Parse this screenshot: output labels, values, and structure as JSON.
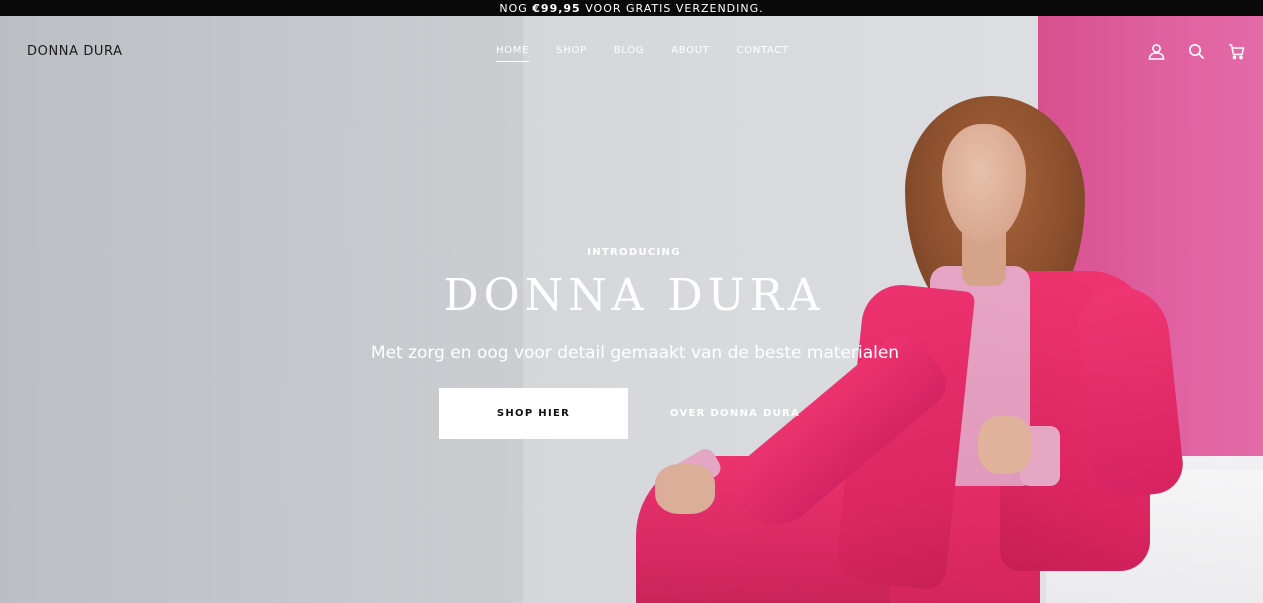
{
  "announcement": {
    "prefix": "NOG ",
    "amount": "€99,95",
    "suffix": " VOOR GRATIS VERZENDING."
  },
  "header": {
    "logo": "DONNA DURA",
    "nav": [
      {
        "label": "HOME",
        "active": true
      },
      {
        "label": "SHOP",
        "active": false
      },
      {
        "label": "BLOG",
        "active": false
      },
      {
        "label": "ABOUT",
        "active": false
      },
      {
        "label": "CONTACT",
        "active": false
      }
    ],
    "icons": [
      "account-icon",
      "search-icon",
      "cart-icon"
    ]
  },
  "hero": {
    "eyebrow": "INTRODUCING",
    "title": "DONNA DURA",
    "subtitle": "Met zorg en oog voor detail gemaakt van de beste materialen",
    "primary_button": "SHOP HIER",
    "secondary_button": "OVER DONNA DURA"
  },
  "colors": {
    "accent_pink": "#e0307a",
    "announcement_bg": "#0a0a0a",
    "text_light": "#ffffff"
  }
}
